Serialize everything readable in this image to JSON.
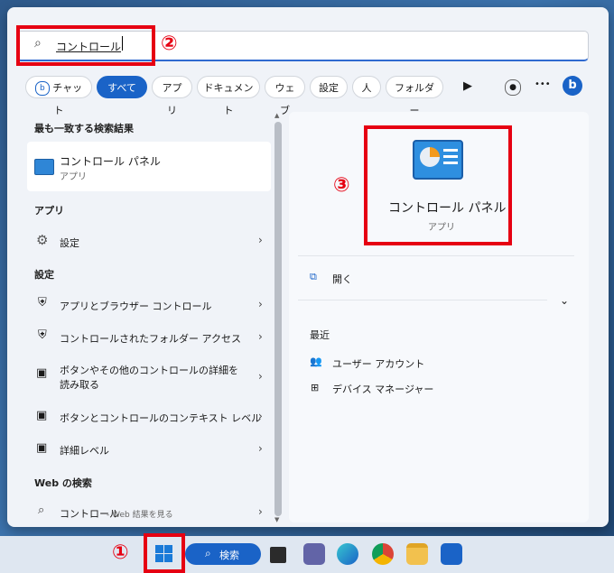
{
  "search": {
    "query": "コントロール"
  },
  "annotations": {
    "step1": "①",
    "step2": "②",
    "step3": "③"
  },
  "filters": [
    "チャット",
    "すべて",
    "アプリ",
    "ドキュメント",
    "ウェブ",
    "設定",
    "人",
    "フォルダー"
  ],
  "more_glyph": "•••",
  "left": {
    "best_match_header": "最も一致する検索結果",
    "best_match": {
      "title": "コントロール パネル",
      "subtitle": "アプリ"
    },
    "apps_header": "アプリ",
    "apps": [
      {
        "label": "設定"
      }
    ],
    "settings_header": "設定",
    "settings": [
      {
        "label": "アプリとブラウザー コントロール"
      },
      {
        "label": "コントロールされたフォルダー アクセス"
      },
      {
        "label": "ボタンやその他のコントロールの詳細を読み取る"
      },
      {
        "label": "ボタンとコントロールのコンテキスト レベル"
      },
      {
        "label": "詳細レベル"
      }
    ],
    "web_header": "Web の検索",
    "web": {
      "label": "コントロール",
      "suffix": " - Web 結果を見る"
    }
  },
  "right": {
    "app_title": "コントロール パネル",
    "app_subtitle": "アプリ",
    "open_label": "開く",
    "recent_header": "最近",
    "recent": [
      {
        "label": "ユーザー アカウント"
      },
      {
        "label": "デバイス マネージャー"
      }
    ]
  },
  "taskbar": {
    "search_label": "検索"
  }
}
